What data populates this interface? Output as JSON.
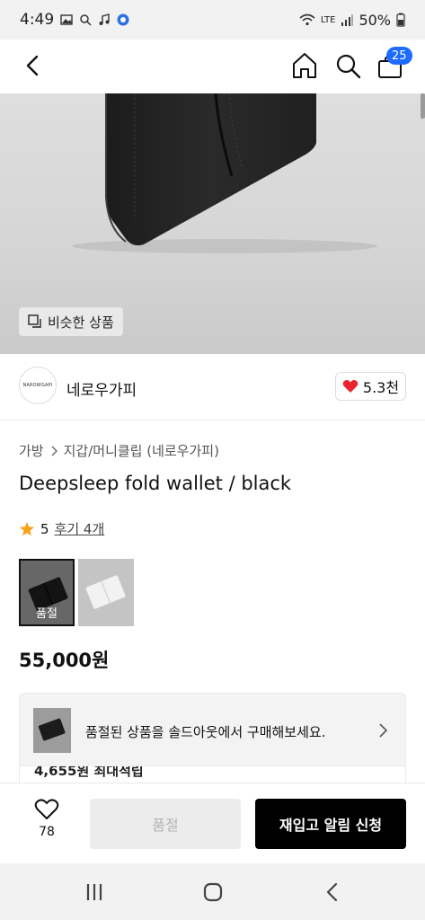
{
  "status_bar": {
    "time": "4:49",
    "battery": "50%",
    "network": "LTE"
  },
  "header": {
    "cart_count": "25"
  },
  "hero": {
    "similar_label": "비슷한 상품"
  },
  "brand": {
    "logo_text": "NAROWGAPI",
    "name": "네로우가피",
    "likes": "5.3천"
  },
  "product": {
    "breadcrumb": [
      "가방",
      "지갑/머니클립 (네로우가피)"
    ],
    "title": "Deepsleep fold wallet / black",
    "rating": "5",
    "review_label": "후기 4개",
    "thumb_soldout_label": "품절",
    "price": "55,000원"
  },
  "soldout_banner": {
    "text": "품절된 상품을 솔드아웃에서 구매해보세요.",
    "points_text": "4,655원 최대적립"
  },
  "bottom_bar": {
    "wish_count": "78",
    "soldout_label": "품절",
    "restock_label": "재입고 알림 신청"
  },
  "colors": {
    "accent": "#1e6bff",
    "heart": "#e8242e",
    "star": "#f7a41d",
    "primary_button": "#000000"
  }
}
